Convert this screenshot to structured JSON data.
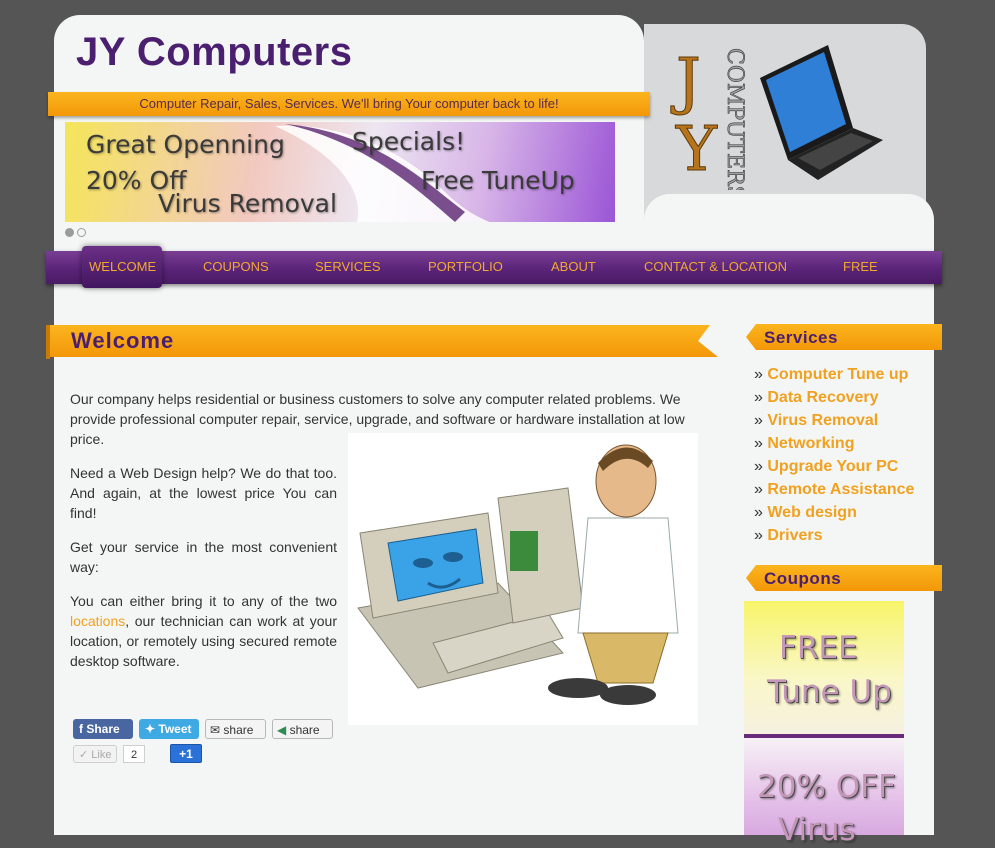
{
  "header": {
    "site_title": "JY Computers",
    "tagline": "Computer Repair, Sales, Services. We'll bring Your computer back to life!"
  },
  "banner": {
    "line1": "Great Openning",
    "line2": "20% Off",
    "line3": "Virus Removal",
    "right1": "Specials!",
    "right2": "Free TuneUp"
  },
  "logo": {
    "letter_j": "J",
    "letter_y": "Y",
    "word": "COMPUTERS"
  },
  "nav": {
    "items": [
      "WELCOME",
      "COUPONS",
      "SERVICES",
      "PORTFOLIO",
      "ABOUT",
      "CONTACT & LOCATION",
      "FREE"
    ]
  },
  "main": {
    "title": "Welcome",
    "p1": "Our company helps residential or business customers to solve any computer related problems. We provide professional computer repair, service, upgrade, and software or hardware installation  at low price.",
    "p2": "Need a Web Design help? We do that too. And again, at the lowest price You can find!",
    "p3": "Get your service in the most convenient way:",
    "p4_before": "You can either bring it to any of the two ",
    "p4_link": "locations",
    "p4_after": ",  our technician can work at your location, or remotely using secured remote desktop software."
  },
  "share": {
    "facebook": "Share",
    "twitter": "Tweet",
    "email": "share",
    "generic": "share",
    "like": "Like",
    "like_count": "2",
    "plus_one": "+1"
  },
  "sidebar": {
    "services_title": "Services",
    "services": [
      "Computer Tune up",
      "Data Recovery",
      "Virus Removal",
      "Networking",
      "Upgrade Your PC",
      "Remote Assistance",
      "Web design",
      "Drivers"
    ],
    "bullet": "»",
    "coupons_title": "Coupons",
    "coupon1_line1": "FREE",
    "coupon1_line2": "Tune Up",
    "coupon2_line1": "20% OFF",
    "coupon2_line2": "Virus"
  },
  "colors": {
    "brand_purple": "#4b1f6f",
    "accent_orange": "#f0a11f",
    "ribbon_orange": "#f7a511",
    "background": "#555556"
  }
}
